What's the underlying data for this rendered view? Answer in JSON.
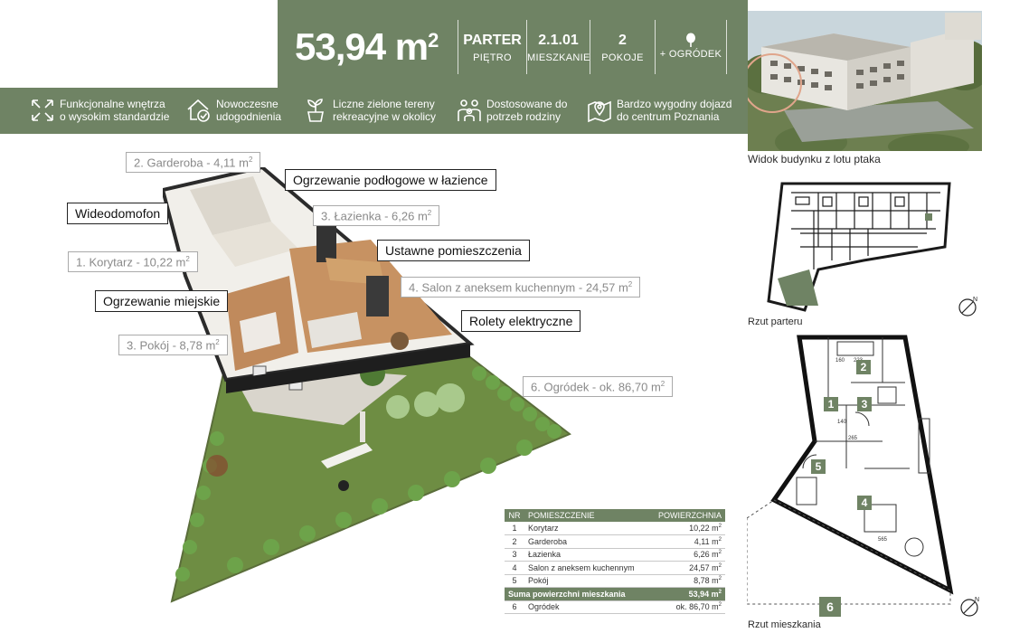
{
  "header": {
    "area_value": "53,94 m",
    "area_sup": "2",
    "stats": [
      {
        "value": "PARTER",
        "label": "PIĘTRO"
      },
      {
        "value": "2.1.01",
        "label": "MIESZKANIE"
      },
      {
        "value": "2",
        "label": "POKOJE"
      },
      {
        "label": "+ OGRÓDEK"
      }
    ]
  },
  "features": [
    {
      "icon": "arrows-expand-icon",
      "line1": "Funkcjonalne wnętrza",
      "line2": "o wysokim standardzie"
    },
    {
      "icon": "home-check-icon",
      "line1": "Nowoczesne",
      "line2": "udogodnienia"
    },
    {
      "icon": "plant-pot-icon",
      "line1": "Liczne zielone tereny",
      "line2": "rekreacyjne w okolicy"
    },
    {
      "icon": "family-icon",
      "line1": "Dostosowane do",
      "line2": "potrzeb rodziny"
    },
    {
      "icon": "map-pin-icon",
      "line1": "Bardzo wygodny dojazd",
      "line2": "do centrum Poznania"
    }
  ],
  "photo": {
    "caption": "Widok budynku z lotu ptaka"
  },
  "callouts": {
    "garderoba": {
      "text": "2. Garderoba - 4,11 m",
      "sup": "2"
    },
    "ogrzewanie_lazienka": "Ogrzewanie podłogowe w łazience",
    "wideodomofon": "Wideodomofon",
    "lazienka": {
      "text": "3. Łazienka - 6,26 m",
      "sup": "2"
    },
    "ustawne": "Ustawne pomieszczenia",
    "korytarz": {
      "text": "1. Korytarz - 10,22 m",
      "sup": "2"
    },
    "salon": {
      "text": "4. Salon z aneksem kuchennym - 24,57 m",
      "sup": "2"
    },
    "ogrzewanie_miejskie": "Ogrzewanie miejskie",
    "rolety": "Rolety elektryczne",
    "pokoj": {
      "text": "3. Pokój - 8,78 m",
      "sup": "2"
    },
    "ogrodek": {
      "text": "6. Ogródek - ok. 86,70 m",
      "sup": "2"
    }
  },
  "table": {
    "headers": {
      "nr": "NR",
      "name": "POMIESZCZENIE",
      "area": "POWIERZCHNIA"
    },
    "rows": [
      {
        "nr": "1",
        "name": "Korytarz",
        "area": "10,22 m"
      },
      {
        "nr": "2",
        "name": "Garderoba",
        "area": "4,11 m"
      },
      {
        "nr": "3",
        "name": "Łazienka",
        "area": "6,26 m"
      },
      {
        "nr": "4",
        "name": "Salon z aneksem kuchennym",
        "area": "24,57 m"
      },
      {
        "nr": "5",
        "name": "Pokój",
        "area": "8,78 m"
      }
    ],
    "sum": {
      "name": "Suma powierzchni mieszkania",
      "area": "53,94 m"
    },
    "garden": {
      "nr": "6",
      "name": "Ogródek",
      "area": "ok. 86,70 m"
    },
    "unit_sup": "2"
  },
  "plans": {
    "parter_caption": "Rzut parteru",
    "mieszkanie_caption": "Rzut mieszkania",
    "room_numbers": [
      "1",
      "2",
      "3",
      "4",
      "5",
      "6"
    ],
    "compass_label": "N",
    "dimensions": [
      "160",
      "223",
      "140",
      "265",
      "565"
    ]
  },
  "colors": {
    "brand_green": "#6f8364",
    "text_dark": "#2b2b2b",
    "callout_gray": "#8a8a8a"
  }
}
